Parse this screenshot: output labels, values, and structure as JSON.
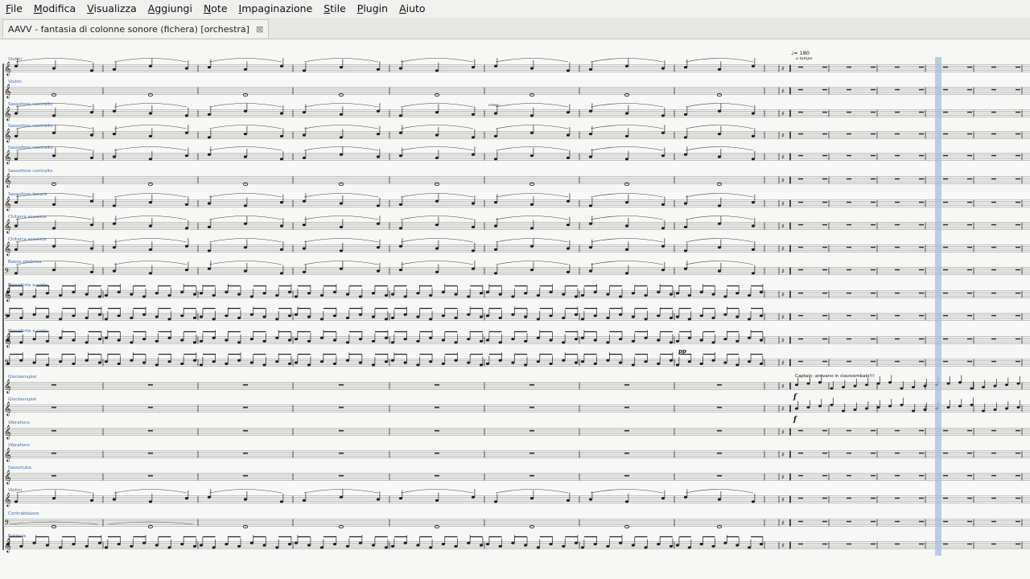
{
  "menu": [
    "File",
    "Modifica",
    "Visualizza",
    "Aggiungi",
    "Note",
    "Impaginazione",
    "Stile",
    "Plugin",
    "Aiuto"
  ],
  "tab": {
    "title": "AAVV - fantasia di colonne sonore (fichera) [orchestra]",
    "close_icon": "close-icon"
  },
  "score": {
    "staff_labels": [
      "Violini",
      "Violini",
      "Sassofono contralto",
      "Sassofono contralto",
      "Sassofono contralto",
      "Sassofono contralto",
      "Sassofono tenore",
      "Chitarra acustica",
      "Chitarra acustica",
      "Basso elettrico",
      "Pianoforte a coda",
      "",
      "Pianoforte a coda",
      "",
      "Glockenspiel",
      "Glockenspiel",
      "Vibrafono",
      "Vibrafono",
      "Sassotuba",
      "Violini",
      "Contrabbasso",
      "Batteria"
    ],
    "tempo_mark": "♩= 180",
    "tempo_text": "a tempo",
    "dynamics": {
      "cresc": "cresc.",
      "pp": "pp",
      "f1": "f",
      "f2": "f"
    },
    "glock_text": "Captain: arrivano in clavicembalo!!!",
    "colors": {
      "staff": "#222222",
      "label": "#3f6fb7",
      "playhead": "#a7bde2"
    }
  }
}
